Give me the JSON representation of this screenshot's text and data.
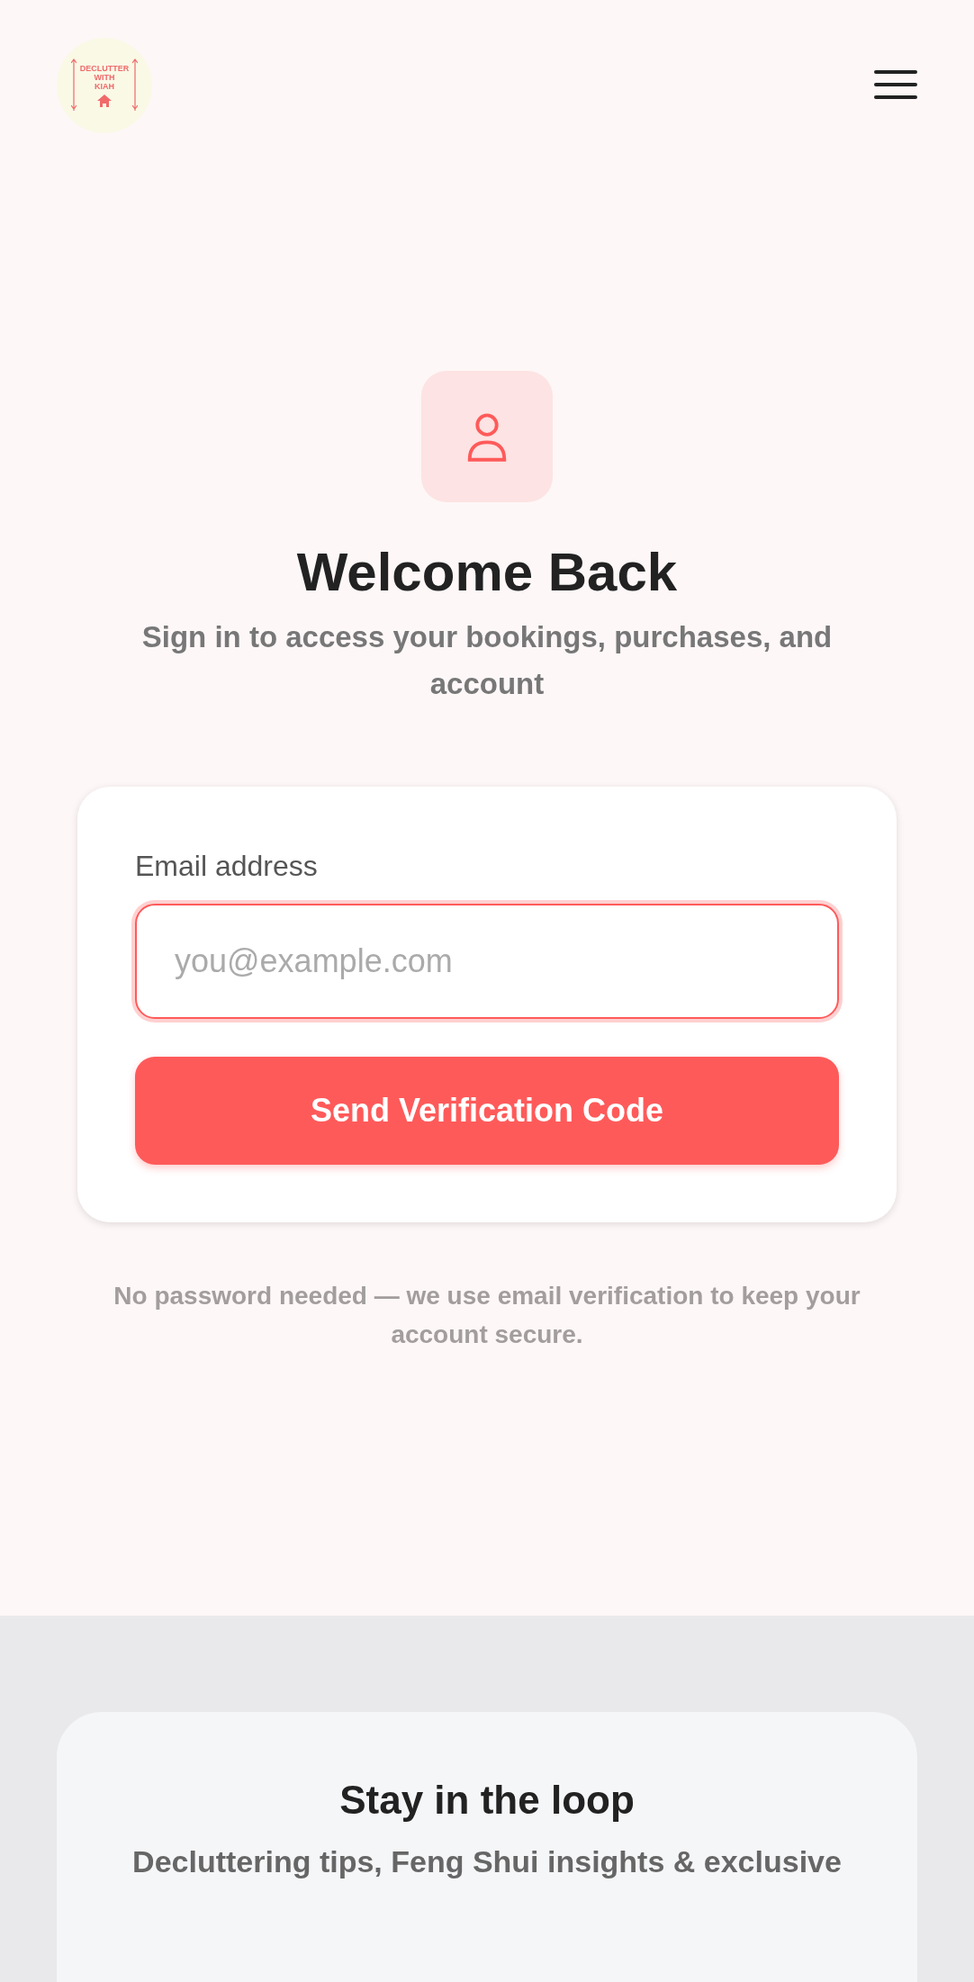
{
  "header": {
    "logo": {
      "lines": [
        "DECLUTTER",
        "WITH",
        "KIAH"
      ]
    }
  },
  "signin": {
    "title": "Welcome Back",
    "subtitle": "Sign in to access your bookings, purchases, and account",
    "email": {
      "label": "Email address",
      "placeholder": "you@example.com"
    },
    "button": "Send Verification Code",
    "note": "No password needed — we use email verification to keep your account secure."
  },
  "newsletter": {
    "title": "Stay in the loop",
    "description": "Decluttering tips, Feng Shui insights & exclusive"
  }
}
